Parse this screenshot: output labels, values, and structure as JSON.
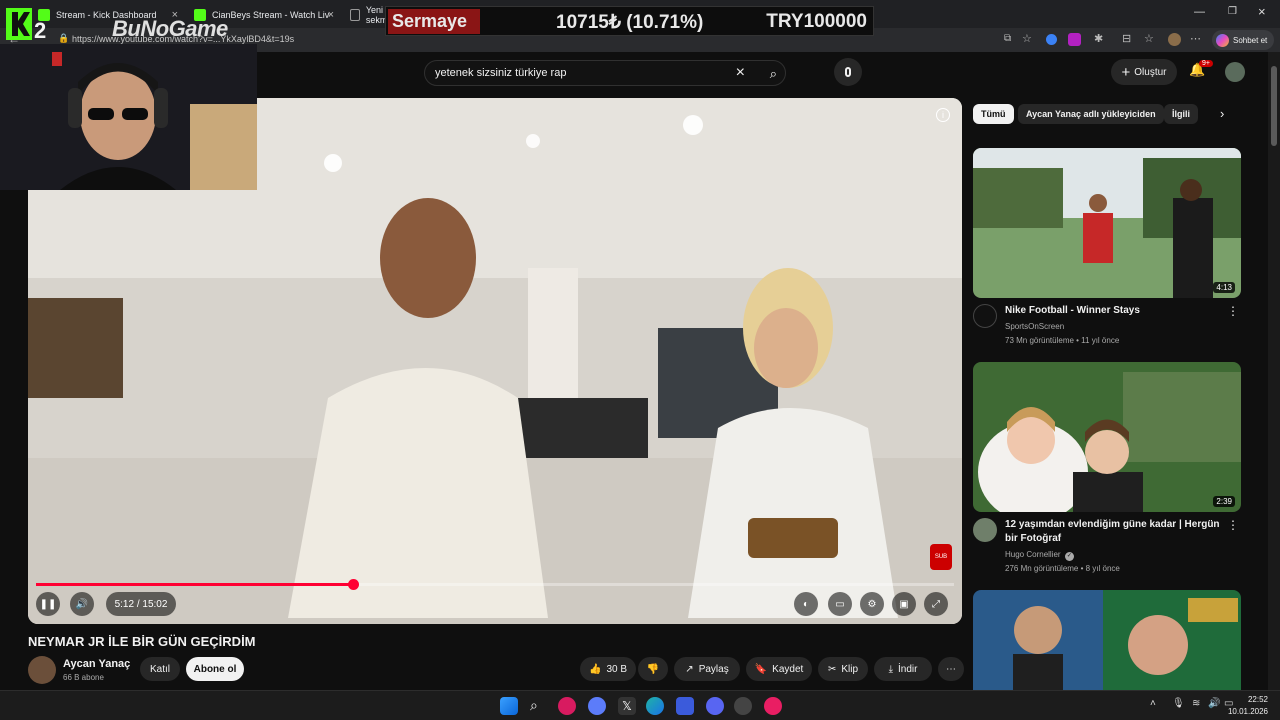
{
  "browser": {
    "tabs": [
      {
        "title": "Stream - Kick Dashboard"
      },
      {
        "title": "CianBeys Stream - Watch Live on Kick"
      },
      {
        "title": "Yeni sekme"
      }
    ],
    "url": "https://www.youtube.com/watch?v=...YkXaylBD4&t=19s",
    "profile_label": "Sohbet et"
  },
  "overlay": {
    "ticker_label": "Sermaye",
    "ticker_value": "10715₺ (10.71%)",
    "ticker_target": "TRY100000",
    "logo_text": "BuNoGame",
    "k2_text": "2"
  },
  "youtube": {
    "search_value": "yetenek sizsiniz türkiye rap",
    "create_label": "Oluştur",
    "notif_count": "9+",
    "video": {
      "time": "5:12 / 15:02",
      "progress": 0.345,
      "title": "NEYMAR JR İLE BİR GÜN GEÇİRDİM",
      "channel": "Aycan Yanaç",
      "subscribers": "66 B abone",
      "join_label": "Katıl",
      "subscribe_label": "Abone ol",
      "likes": "30 B",
      "share_label": "Paylaş",
      "save_label": "Kaydet",
      "clip_label": "Klip",
      "download_label": "İndir"
    },
    "chips": [
      "Tümü",
      "Aycan Yanaç adlı yükleyiciden",
      "İlgili"
    ],
    "recommendations": [
      {
        "title": "Nike Football - Winner Stays",
        "channel": "SportsOnScreen",
        "meta": "73 Mn görüntüleme • 11 yıl önce",
        "duration": "4:13"
      },
      {
        "title": "12 yaşımdan evlendiğim güne kadar | Hergün bir Fotoğraf",
        "channel": "Hugo Cornellier",
        "meta": "276 Mn görüntüleme • 8 yıl önce",
        "duration": "2:39"
      }
    ]
  },
  "taskbar": {
    "time": "22:52",
    "date": "10.01.2026"
  }
}
